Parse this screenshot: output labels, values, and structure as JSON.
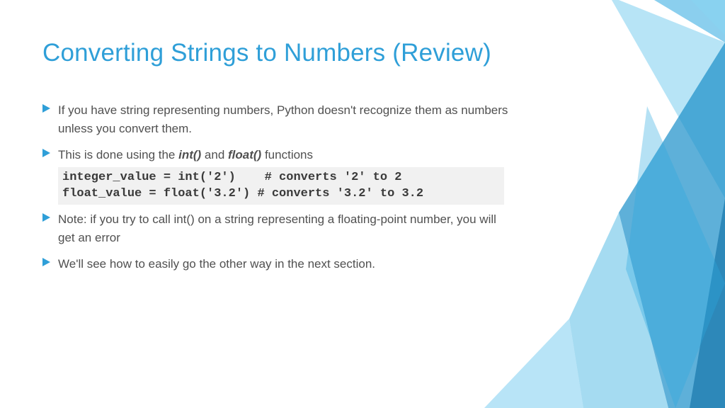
{
  "title": "Converting Strings to Numbers (Review)",
  "bullets": [
    {
      "text": "If you have string representing numbers, Python doesn't recognize them as numbers unless you convert them."
    },
    {
      "text_html": "This is done using the <em>int()</em> and <em>float()</em> functions",
      "code": "integer_value = int('2')    # converts '2' to 2\nfloat_value = float('3.2') # converts '3.2' to 3.2"
    },
    {
      "text": "Note: if you try to call int() on a string representing a floating-point number, you will get an error"
    },
    {
      "text": "We'll see how to easily go the other way in the next section."
    }
  ]
}
